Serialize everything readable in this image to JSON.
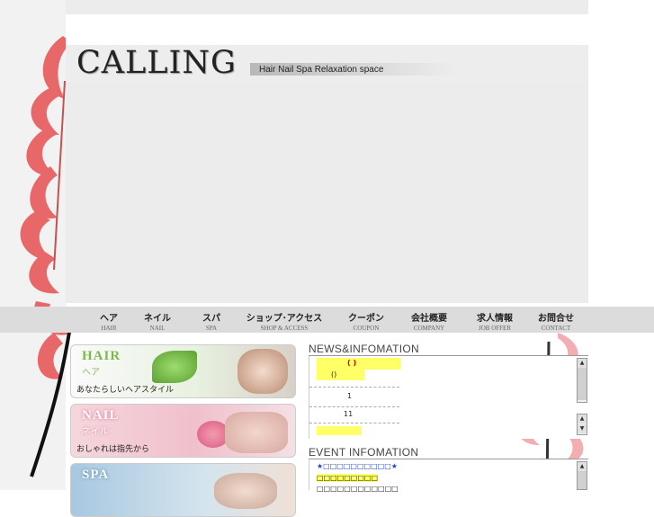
{
  "header": {
    "logo_text": "CALLING",
    "tagline": "Hair Nail Spa Relaxation space"
  },
  "nav": {
    "items": [
      {
        "jp": "ヘア",
        "en": "HAIR"
      },
      {
        "jp": "ネイル",
        "en": "NAIL"
      },
      {
        "jp": "スパ",
        "en": "SPA"
      },
      {
        "jp": "ショップ･アクセス",
        "en": "SHOP & ACCESS"
      },
      {
        "jp": "クーポン",
        "en": "COUPON"
      },
      {
        "jp": "会社概要",
        "en": "COMPANY"
      },
      {
        "jp": "求人情報",
        "en": "JOB OFFER"
      },
      {
        "jp": "お問合せ",
        "en": "CONTACT"
      }
    ]
  },
  "banners": {
    "hair": {
      "title": "HAIR",
      "sub": "ヘア",
      "desc": "あなたらしいヘアスタイル"
    },
    "nail": {
      "title": "NAIL",
      "sub": "ネイル",
      "desc": "おしゃれは指先から"
    },
    "spa": {
      "title": "SPA"
    }
  },
  "news": {
    "heading": "NEWS&INFOMATION",
    "line1": "(    )",
    "line2": "()",
    "line3": "1",
    "line4": "11"
  },
  "event": {
    "heading": "EVENT INFOMATION",
    "line1": "★□□□□□□□□□□★",
    "line2": "□□□□□□□□□",
    "line3": "□□□□□□□□□□□□"
  },
  "colors": {
    "leaf": "#e8686a",
    "highlight": "#ffff66"
  }
}
